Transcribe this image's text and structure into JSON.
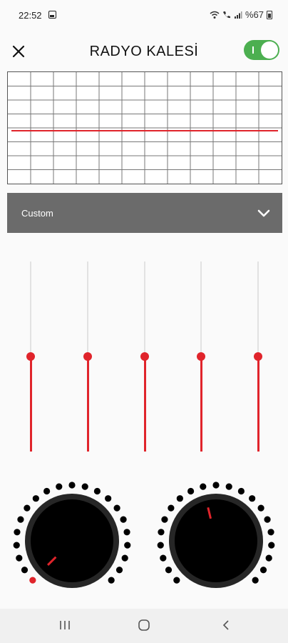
{
  "status_bar": {
    "time": "22:52",
    "battery": "%67",
    "icons": [
      "gallery-icon",
      "wifi-icon",
      "wifi-calling-icon",
      "signal-icon",
      "battery-icon"
    ]
  },
  "app_bar": {
    "title": "RADYO KALESİ",
    "close_icon": "close-icon",
    "power_enabled": true
  },
  "equalizer": {
    "graph": {
      "grid_columns": 12,
      "grid_rows": 8,
      "line_level": 0.5,
      "line_color": "#e0242b"
    },
    "preset": {
      "selected": "Custom",
      "icon": "chevron-down-icon"
    },
    "bands": [
      {
        "level": 0.5
      },
      {
        "level": 0.5
      },
      {
        "level": 0.5
      },
      {
        "level": 0.5
      },
      {
        "level": 0.5
      }
    ]
  },
  "knobs": [
    {
      "name": "bass-boost",
      "value": 0.0,
      "lit_dots": 1
    },
    {
      "name": "virtualizer",
      "value": 0.45,
      "lit_dots": 0
    }
  ],
  "colors": {
    "accent": "#e0242b",
    "toggle_on": "#4caf50",
    "preset_bg": "#6b6b6b",
    "knob_body": "#000000"
  },
  "nav_bar": {
    "icons": [
      "recent-apps-icon",
      "home-icon",
      "back-icon"
    ]
  }
}
